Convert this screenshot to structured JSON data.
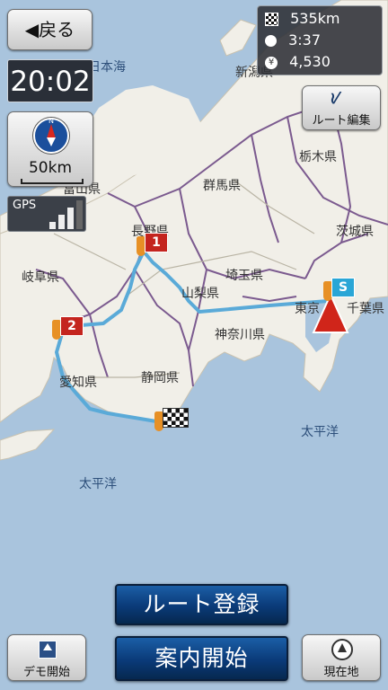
{
  "nav": {
    "back_label": "◀戻る",
    "time": "20:02",
    "scale": "50km",
    "gps_label": "GPS",
    "route_edit_label": "ルート編集",
    "compass_letter": "N"
  },
  "route_info": {
    "distance": "535km",
    "duration": "3:37",
    "toll": "4,530"
  },
  "flags": {
    "start": "S",
    "waypoint1": "1",
    "waypoint2": "2"
  },
  "map_labels": {
    "nihonkai": "日本海",
    "niigata": "新潟県",
    "tochigi": "栃木県",
    "toyama": "富山県",
    "gunma": "群馬県",
    "ibaraki": "茨城県",
    "nagano": "長野県",
    "gifu": "岐阜県",
    "saitama": "埼玉県",
    "yamanashi": "山梨県",
    "tokyo": "東京",
    "chiba": "千葉県",
    "kanagawa": "神奈川県",
    "aichi": "愛知県",
    "shizuoka": "静岡県",
    "pacific_east": "太平洋",
    "pacific_west": "太平洋"
  },
  "buttons": {
    "register_route": "ルート登録",
    "start_guidance": "案内開始",
    "demo_start": "デモ開始",
    "current_location": "現在地"
  },
  "colors": {
    "route": "#5aaad8",
    "land": "#f1efe8",
    "sea": "#a9c4dd",
    "boundary": "#7b5a8f"
  }
}
